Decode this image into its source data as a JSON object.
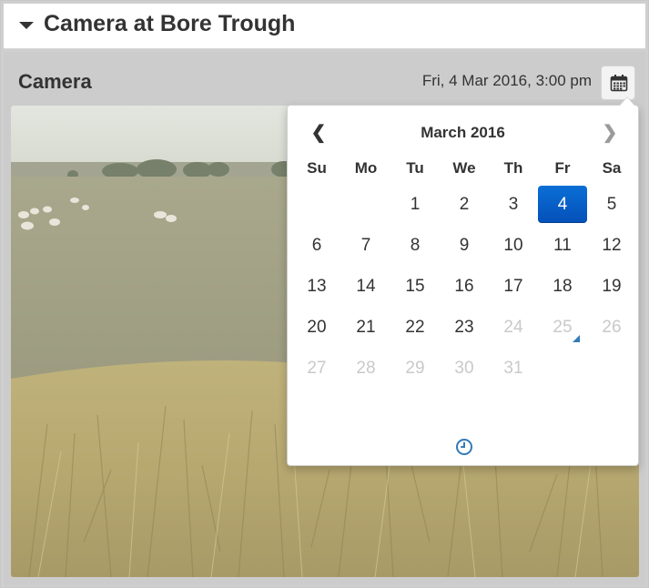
{
  "panel": {
    "title": "Camera at Bore Trough"
  },
  "camera": {
    "label": "Camera",
    "datetime": "Fri, 4 Mar 2016, 3:00 pm",
    "calendar_icon": "calendar-icon"
  },
  "datepicker": {
    "month_title": "March 2016",
    "prev_glyph": "❮",
    "next_glyph": "❯",
    "days_of_week": [
      "Su",
      "Mo",
      "Tu",
      "We",
      "Th",
      "Fr",
      "Sa"
    ],
    "weeks": [
      [
        {
          "label": ""
        },
        {
          "label": ""
        },
        {
          "label": "1"
        },
        {
          "label": "2"
        },
        {
          "label": "3"
        },
        {
          "label": "4",
          "state": "active"
        },
        {
          "label": "5"
        }
      ],
      [
        {
          "label": "6"
        },
        {
          "label": "7"
        },
        {
          "label": "8"
        },
        {
          "label": "9"
        },
        {
          "label": "10"
        },
        {
          "label": "11"
        },
        {
          "label": "12"
        }
      ],
      [
        {
          "label": "13"
        },
        {
          "label": "14"
        },
        {
          "label": "15"
        },
        {
          "label": "16"
        },
        {
          "label": "17"
        },
        {
          "label": "18"
        },
        {
          "label": "19"
        }
      ],
      [
        {
          "label": "20"
        },
        {
          "label": "21"
        },
        {
          "label": "22"
        },
        {
          "label": "23"
        },
        {
          "label": "24",
          "state": "muted"
        },
        {
          "label": "25",
          "state": "muted today"
        },
        {
          "label": "26",
          "state": "muted"
        }
      ],
      [
        {
          "label": "27",
          "state": "muted"
        },
        {
          "label": "28",
          "state": "muted"
        },
        {
          "label": "29",
          "state": "muted"
        },
        {
          "label": "30",
          "state": "muted"
        },
        {
          "label": "31",
          "state": "muted"
        },
        {
          "label": ""
        },
        {
          "label": ""
        }
      ]
    ],
    "time_toggle_icon": "clock-icon"
  },
  "colors": {
    "active_day": "#0a6fd6",
    "muted_day": "#c9c9c9",
    "clock_icon": "#337ab7",
    "today_marker": "#337ab7"
  }
}
